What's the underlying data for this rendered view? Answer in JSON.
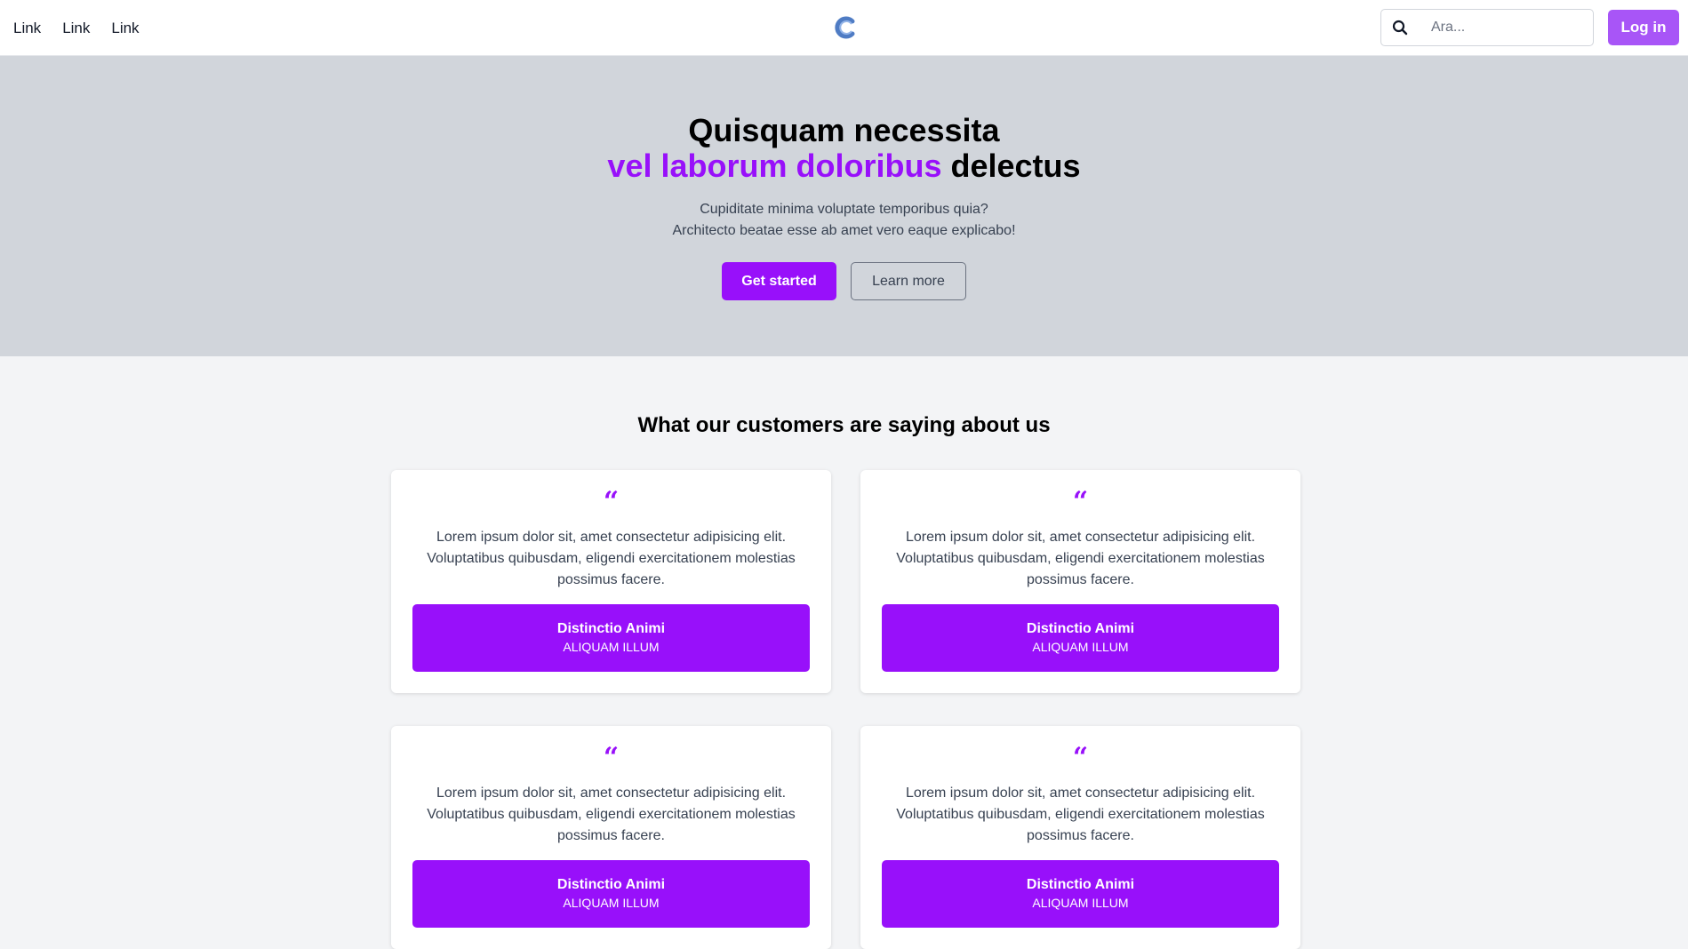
{
  "header": {
    "nav_links": [
      "Link",
      "Link",
      "Link"
    ],
    "search_placeholder": "Ara...",
    "login_label": "Log in"
  },
  "hero": {
    "title_line1": "Quisquam necessita",
    "title_accent": "vel laborum doloribus",
    "title_end": "delectus",
    "subtitle_line1": "Cupiditate minima voluptate temporibus quia?",
    "subtitle_line2": "Architecto beatae esse ab amet vero eaque explicabo!",
    "primary_label": "Get started",
    "secondary_label": "Learn more"
  },
  "testimonials": {
    "title": "What our customers are saying about us",
    "items": [
      {
        "text": "Lorem ipsum dolor sit, amet consectetur adipisicing elit. Voluptatibus quibusdam, eligendi exercitationem molestias possimus facere.",
        "name": "Distinctio Animi",
        "role": "ALIQUAM ILLUM"
      },
      {
        "text": "Lorem ipsum dolor sit, amet consectetur adipisicing elit. Voluptatibus quibusdam, eligendi exercitationem molestias possimus facere.",
        "name": "Distinctio Animi",
        "role": "ALIQUAM ILLUM"
      },
      {
        "text": "Lorem ipsum dolor sit, amet consectetur adipisicing elit. Voluptatibus quibusdam, eligendi exercitationem molestias possimus facere.",
        "name": "Distinctio Animi",
        "role": "ALIQUAM ILLUM"
      },
      {
        "text": "Lorem ipsum dolor sit, amet consectetur adipisicing elit. Voluptatibus quibusdam, eligendi exercitationem molestias possimus facere.",
        "name": "Distinctio Animi",
        "role": "ALIQUAM ILLUM"
      }
    ]
  },
  "colors": {
    "accent": "#9810fa",
    "login_button": "#a855f7",
    "hero_background": "#d1d5db",
    "page_background": "#f3f4f6"
  }
}
